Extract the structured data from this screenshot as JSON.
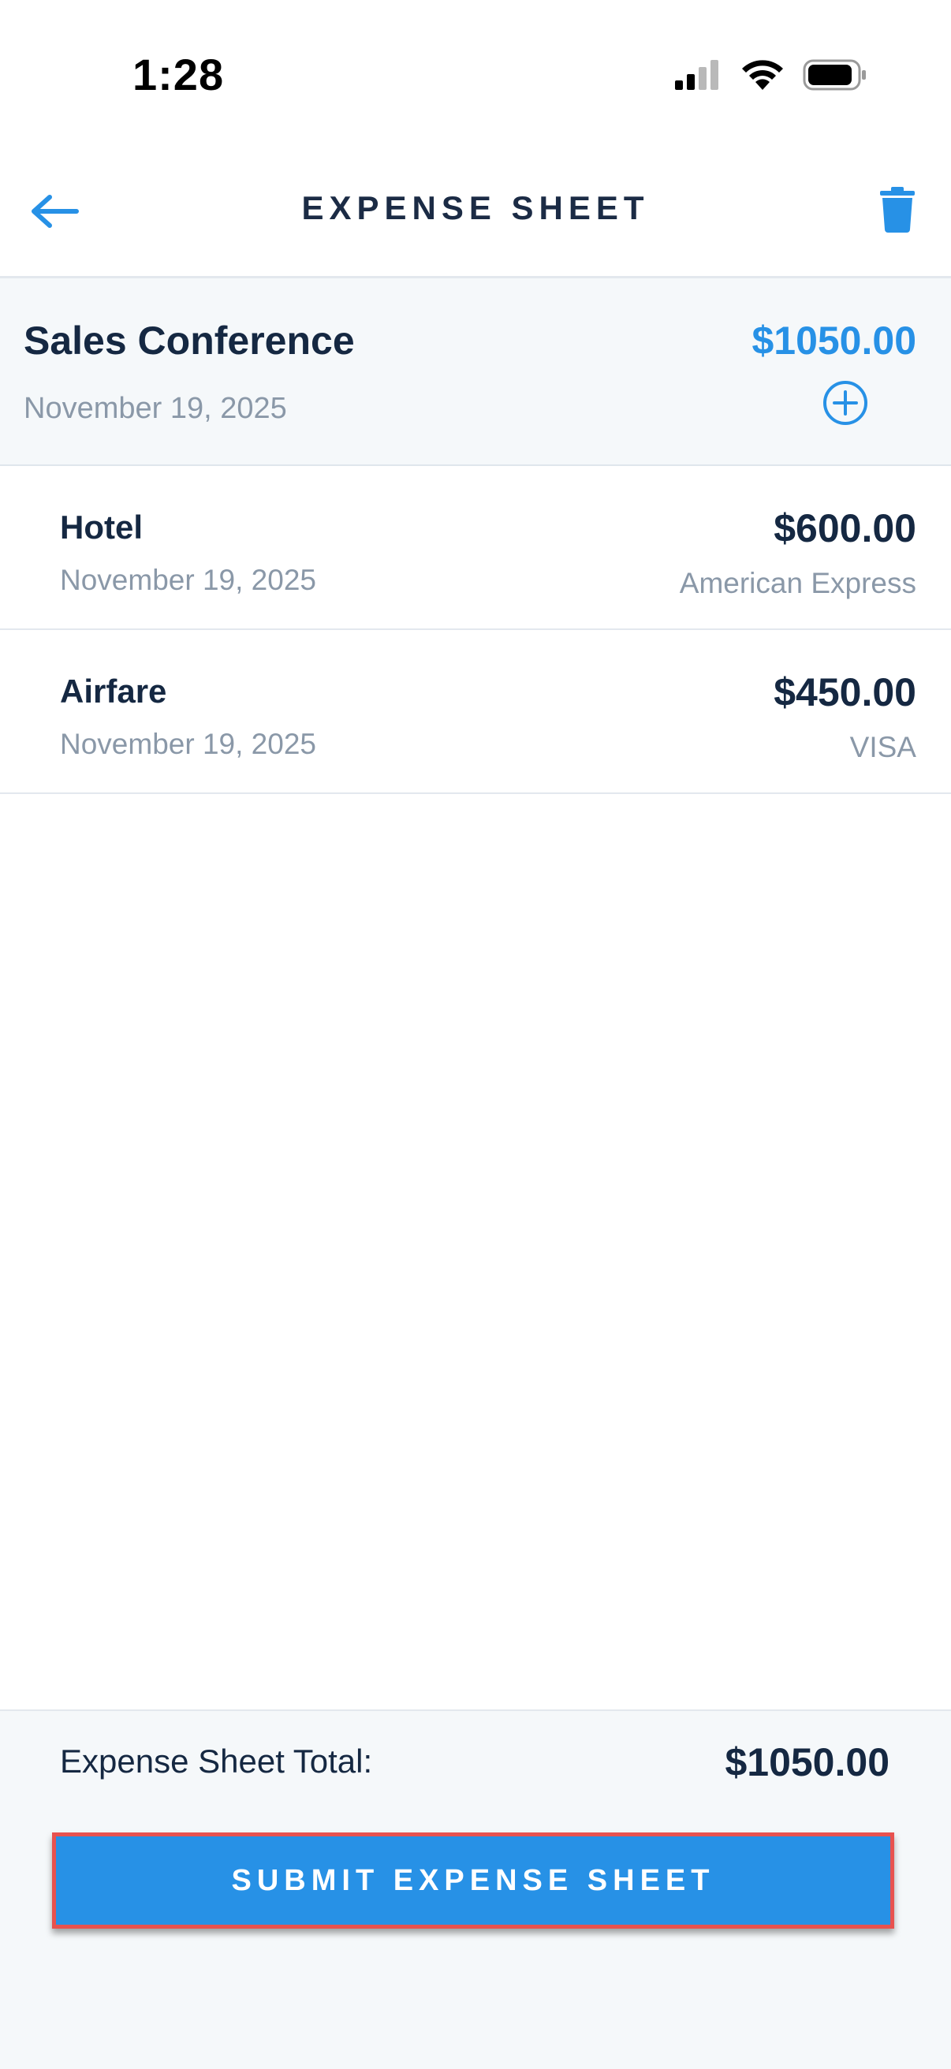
{
  "status_bar": {
    "time": "1:28"
  },
  "header": {
    "title": "EXPENSE SHEET",
    "back_icon": "arrow-left-icon",
    "delete_icon": "trash-icon"
  },
  "sheet": {
    "name": "Sales Conference",
    "date": "November 19, 2025",
    "total": "$1050.00",
    "add_icon": "plus-circle-icon"
  },
  "items": [
    {
      "name": "Hotel",
      "date": "November 19, 2025",
      "amount": "$600.00",
      "payment_method": "American Express"
    },
    {
      "name": "Airfare",
      "date": "November 19, 2025",
      "amount": "$450.00",
      "payment_method": "VISA"
    }
  ],
  "footer": {
    "total_label": "Expense Sheet Total:",
    "total_value": "$1050.00",
    "submit_label": "SUBMIT EXPENSE SHEET"
  },
  "colors": {
    "accent": "#2791e6",
    "text_dark": "#152842",
    "text_muted": "#8a98a8",
    "highlight_border": "#e8524f"
  }
}
